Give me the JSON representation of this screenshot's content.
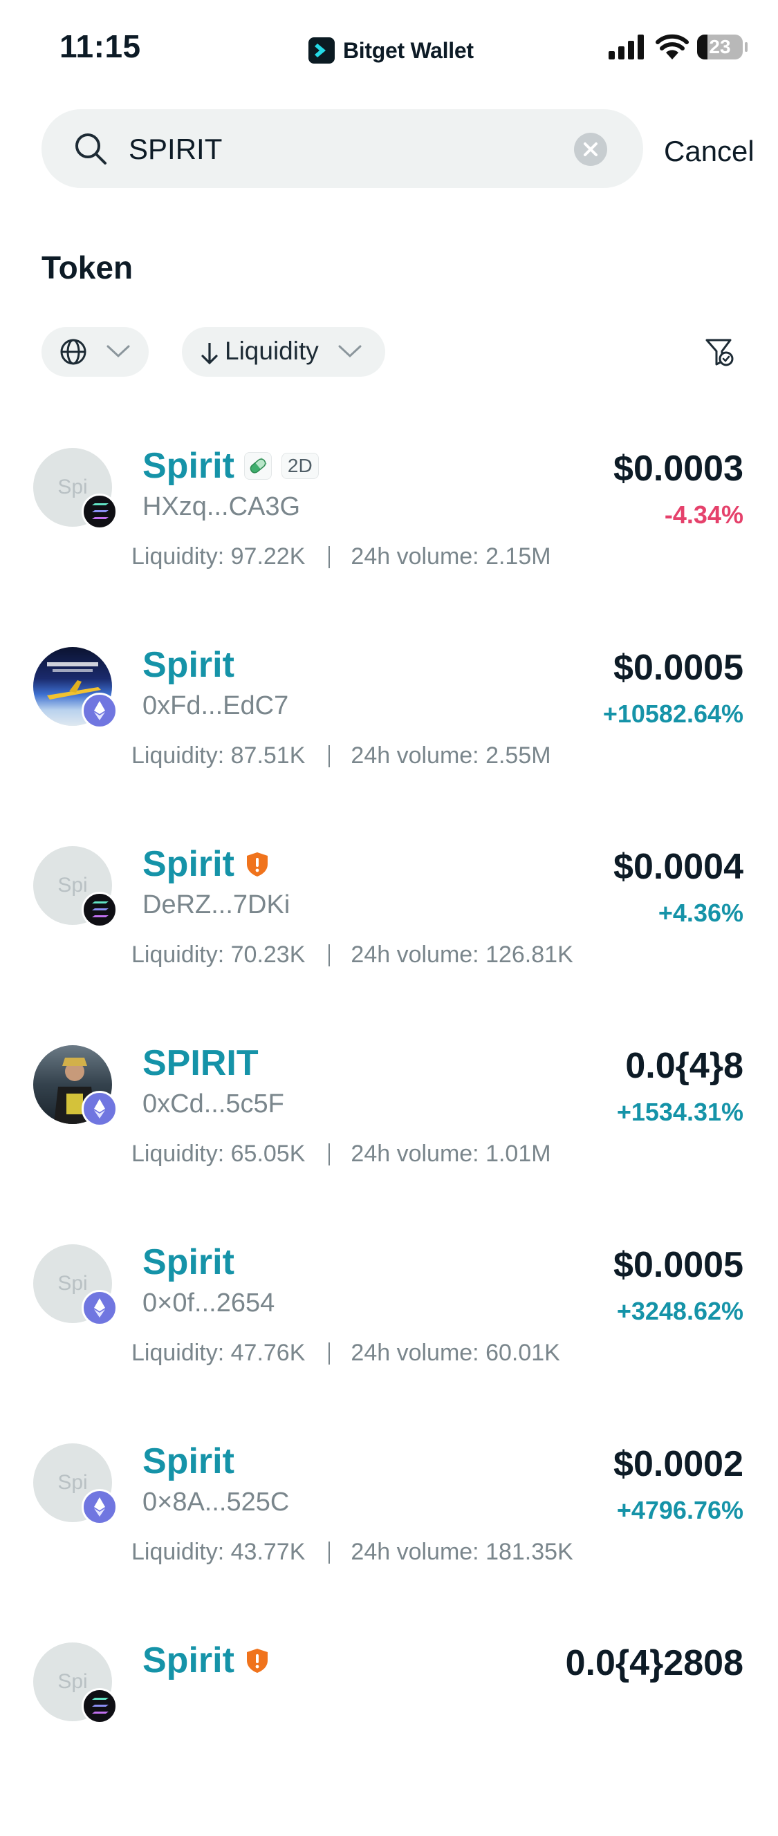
{
  "status": {
    "time": "11:15",
    "app_name": "Bitget Wallet",
    "battery": "23",
    "battery_level": 0.23
  },
  "search": {
    "value": "SPIRIT",
    "cancel_label": "Cancel"
  },
  "section": {
    "title": "Token"
  },
  "filters": {
    "sort_label": "Liquidity"
  },
  "tokens": [
    {
      "name": "Spirit",
      "avatar_text": "Spi",
      "chain": "solana",
      "address": "HXzq...CA3G",
      "price": "$0.0003",
      "change": "-4.34%",
      "direction": "down",
      "liquidity": "Liquidity: 97.22K",
      "volume": "24h volume: 2.15M",
      "tag": "2D",
      "badge": "pill"
    },
    {
      "name": "Spirit",
      "avatar_text": "",
      "chain": "ethereum",
      "address": "0xFd...EdC7",
      "price": "$0.0005",
      "change": "+10582.64%",
      "direction": "up",
      "liquidity": "Liquidity: 87.51K",
      "volume": "24h volume: 2.55M"
    },
    {
      "name": "Spirit",
      "avatar_text": "Spi",
      "chain": "solana",
      "address": "DeRZ...7DKi",
      "price": "$0.0004",
      "change": "+4.36%",
      "direction": "up",
      "liquidity": "Liquidity: 70.23K",
      "volume": "24h volume: 126.81K",
      "badge": "warning"
    },
    {
      "name": "SPIRIT",
      "avatar_text": "",
      "chain": "ethereum",
      "address": "0xCd...5c5F",
      "price": "0.0{4}8",
      "change": "+1534.31%",
      "direction": "up",
      "liquidity": "Liquidity: 65.05K",
      "volume": "24h volume: 1.01M"
    },
    {
      "name": "Spirit",
      "avatar_text": "Spi",
      "chain": "ethereum",
      "address": "0×0f...2654",
      "price": "$0.0005",
      "change": "+3248.62%",
      "direction": "up",
      "liquidity": "Liquidity: 47.76K",
      "volume": "24h volume: 60.01K"
    },
    {
      "name": "Spirit",
      "avatar_text": "Spi",
      "chain": "ethereum",
      "address": "0×8A...525C",
      "price": "$0.0002",
      "change": "+4796.76%",
      "direction": "up",
      "liquidity": "Liquidity: 43.77K",
      "volume": "24h volume: 181.35K"
    },
    {
      "name": "Spirit",
      "avatar_text": "Spi",
      "chain": "solana",
      "address": "",
      "price": "0.0{4}2808",
      "change": "",
      "direction": "up",
      "liquidity": "",
      "volume": "",
      "badge": "warning"
    }
  ],
  "colors": {
    "accent": "#1593a8",
    "negative": "#e5416b",
    "warning": "#f0731c",
    "eth": "#7076e0"
  }
}
